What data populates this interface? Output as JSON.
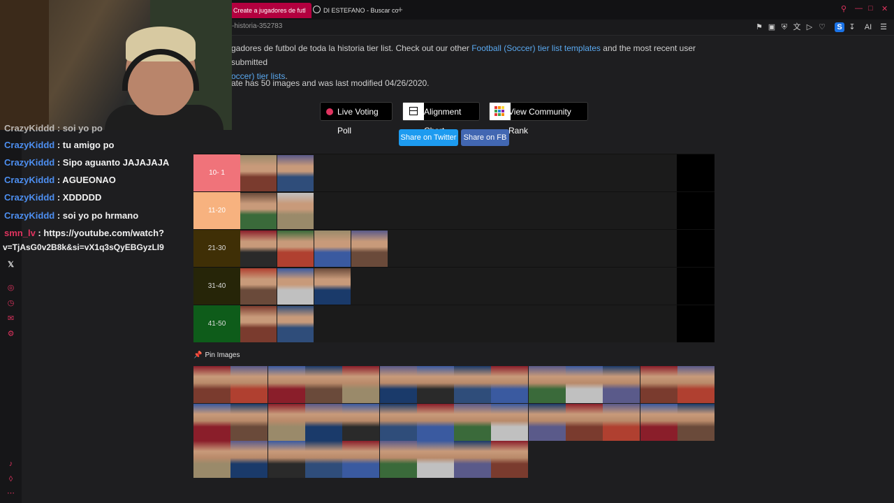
{
  "browser": {
    "tabs": [
      {
        "label": "Create a jugadores de futl",
        "active": true
      },
      {
        "label": "DI ESTEFANO - Buscar co",
        "active": false
      }
    ],
    "url_fragment": "-historia-352783"
  },
  "content": {
    "description_prefix": "gadores de futbol de toda la historia tier list. Check out our other ",
    "link1": "Football (Soccer) tier list templates",
    "description_mid": " and the most recent user submitted",
    "link2": "occer) tier lists",
    "description_end": ".",
    "modified_text": "ate has 50 images and was last modified 04/26/2020."
  },
  "actions": {
    "live_voting": "Live Voting Poll",
    "alignment_chart": "Alignment Chart",
    "community_rank": "View Community Rank",
    "share_twitter": "Share on Twitter",
    "share_fb": "Share on FB"
  },
  "tiers": [
    {
      "label": "10- 1",
      "color": "#f0737a",
      "text_color": "#ffffff",
      "count": 2
    },
    {
      "label": "11-20",
      "color": "#f7b27f",
      "text_color": "#ffffff",
      "count": 2
    },
    {
      "label": "21-30",
      "color": "#3f2f06",
      "text_color": "#dddddd",
      "count": 4
    },
    {
      "label": "31-40",
      "color": "#262508",
      "text_color": "#dddddd",
      "count": 3
    },
    {
      "label": "41-50",
      "color": "#0e5c1a",
      "text_color": "#dddddd",
      "count": 2
    }
  ],
  "pin_label": "Pin Images",
  "pool_count": 37,
  "chat": {
    "partial_top": "CrazyKiddd : soi yo po",
    "messages": [
      {
        "user": "CrazyKiddd",
        "text": " : tu amigo po"
      },
      {
        "user": "CrazyKiddd",
        "text": " : Sipo aguanto JAJAJAJA"
      },
      {
        "user": "CrazyKiddd",
        "text": " : AGUEONAO"
      },
      {
        "user": "CrazyKiddd",
        "text": " : XDDDDD"
      },
      {
        "user": "CrazyKiddd",
        "text": " : soi yo po hrmano"
      }
    ],
    "link_user": "smn_lv",
    "link_text": " : https://youtube.com/watch?",
    "link_cont": "v=TjAsG0v2B8k&si=vX1q3sQyEBGyzLI9"
  }
}
